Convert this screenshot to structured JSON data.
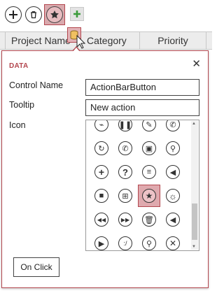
{
  "action_bar": {
    "buttons": [
      {
        "icon": "plus-icon"
      },
      {
        "icon": "trash-icon"
      },
      {
        "icon": "star-icon",
        "selected": true
      }
    ],
    "new_button_icon": "green-plus-icon"
  },
  "table": {
    "headers": [
      "Project Name",
      "Category",
      "Priority"
    ]
  },
  "popup": {
    "title": "DATA",
    "close_symbol": "✕",
    "control_name_label": "Control Name",
    "control_name_value": "ActionBarButton",
    "tooltip_label": "Tooltip",
    "tooltip_value": "New action",
    "icon_label": "Icon",
    "on_click_label": "On Click",
    "icons": [
      [
        "paperclip-icon",
        "pause-icon",
        "pencil-icon",
        "phone-icon"
      ],
      [
        "phone-arrows-icon",
        "phone-add-icon",
        "photo-icon",
        "pin-icon"
      ],
      [
        "plus-icon",
        "question-icon",
        "run-icon",
        "speaker-icon"
      ],
      [
        "speech-bubble-icon",
        "speech-plus-icon",
        "star-icon",
        "sun-icon"
      ],
      [
        "skip-back-icon",
        "skip-forward-icon",
        "trash-icon",
        "triangle-left-icon"
      ],
      [
        "play-icon",
        "slash-icon",
        "walk-icon",
        "x-icon"
      ]
    ],
    "selected_icon": "star-icon"
  },
  "colors": {
    "accent": "#b3474f",
    "selection_fill": "#dfa9ae",
    "header_bg": "#ececec",
    "new_icon_green": "#3c9c3c"
  }
}
